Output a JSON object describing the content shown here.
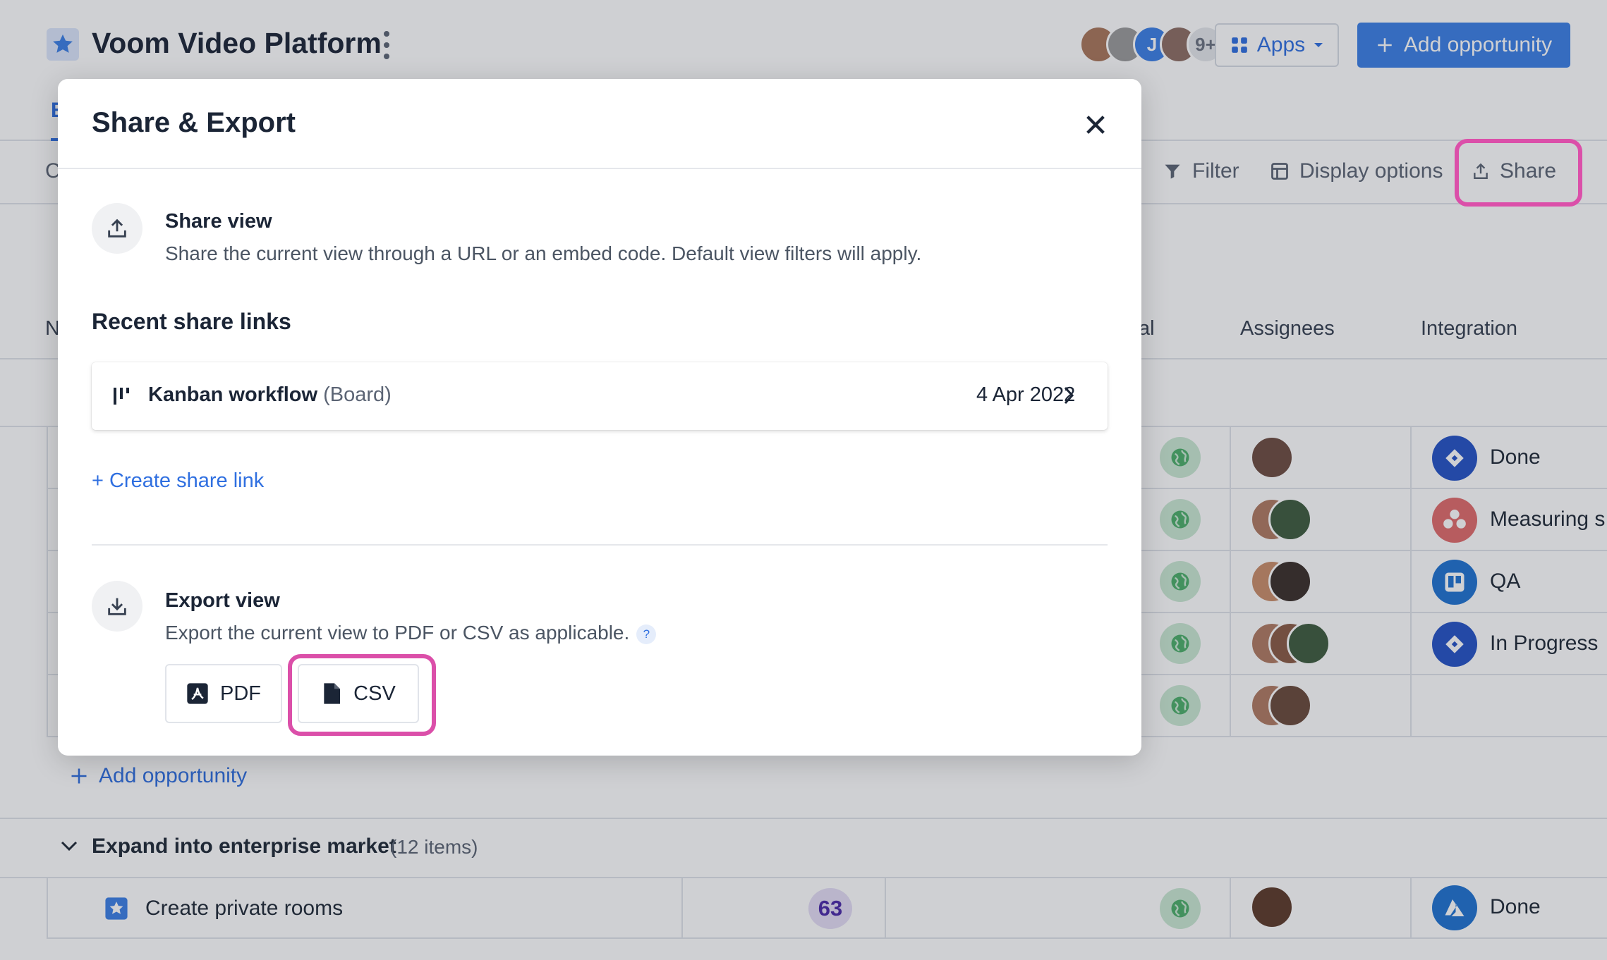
{
  "header": {
    "title": "Voom Video Platform",
    "avatars": [
      {
        "initial": "",
        "color": "#a9775a"
      },
      {
        "initial": "",
        "color": "#9a9a9a"
      },
      {
        "initial": "J",
        "color": "#3b7fe6"
      },
      {
        "initial": "",
        "color": "#8d6e63"
      }
    ],
    "avatars_more": "9+",
    "apps_label": "Apps",
    "add_opportunity_label": "Add opportunity"
  },
  "toolbar": {
    "filter_label": "Filter",
    "display_options_label": "Display options",
    "share_label": "Share"
  },
  "table": {
    "columns": {
      "partial_col": "al",
      "assignees": "Assignees",
      "integration": "Integration",
      "left_fragment": "N"
    },
    "rows": [
      {
        "integration": "Done",
        "integration_color": "#2453c6"
      },
      {
        "integration": "Measuring s",
        "integration_color": "#e06b6b"
      },
      {
        "integration": "QA",
        "integration_color": "#1f73d1"
      },
      {
        "integration": "In Progress",
        "integration_color": "#2453c6"
      },
      {
        "integration": "",
        "integration_color": ""
      }
    ],
    "add_opportunity_label": "Add opportunity",
    "group": {
      "title": "Expand into enterprise market",
      "count": "(12 items)"
    },
    "group_row": {
      "name": "Create private rooms",
      "score": "63",
      "integration": "Done"
    }
  },
  "modal": {
    "title": "Share & Export",
    "share_view": {
      "title": "Share view",
      "description": "Share the current view through a URL or an embed code. Default view filters will apply."
    },
    "recent_title": "Recent share links",
    "recent_links": [
      {
        "name": "Kanban workflow",
        "type": "(Board)",
        "date": "4 Apr 2022"
      }
    ],
    "create_link_label": "+ Create share link",
    "export_view": {
      "title": "Export view",
      "description": "Export the current view to PDF or CSV as applicable.",
      "help": "?",
      "pdf_label": "PDF",
      "csv_label": "CSV"
    }
  },
  "colors": {
    "accent": "#3b7fe6",
    "highlight": "#db4fa9",
    "link": "#2f6fe0"
  }
}
